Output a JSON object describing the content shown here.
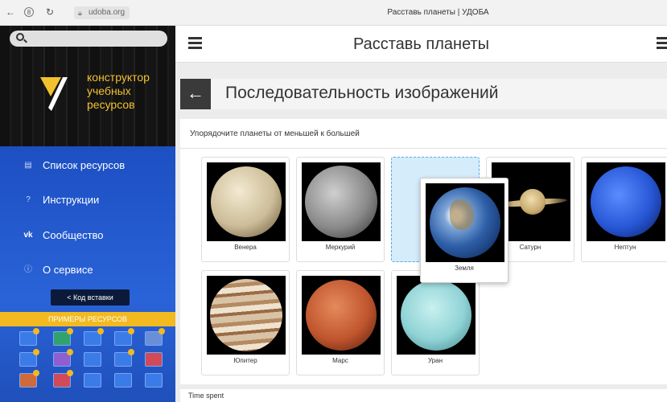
{
  "browser": {
    "back_icon": "back-arrow-icon",
    "url": "udoba.org",
    "tab_title": "Расставь планеты | УДОБА"
  },
  "sidebar": {
    "logo_text": [
      "конструктор",
      "учебных",
      "ресурсов"
    ],
    "logo_colors": {
      "yellow": "#f2c12e",
      "white": "#ffffff"
    },
    "menu": [
      {
        "icon": "list-icon",
        "label": "Список ресурсов"
      },
      {
        "icon": "help-icon",
        "label": "Инструкции"
      },
      {
        "icon": "vk-icon",
        "label": "Сообщество"
      },
      {
        "icon": "info-icon",
        "label": "О сервисе"
      }
    ],
    "embed_label": "Код вставки",
    "examples_label": "ПРИМЕРЫ РЕСУРСОВ"
  },
  "header": {
    "title": "Расставь планеты"
  },
  "exercise": {
    "title": "Последовательность изображений",
    "instruction": "Упорядочите планеты от меньшей к большей",
    "cards": [
      {
        "label": "Венера"
      },
      {
        "label": "Меркурий"
      },
      {
        "label": "Сатурн"
      },
      {
        "label": "Нептун"
      },
      {
        "label": "Юпитер"
      },
      {
        "label": "Марс"
      },
      {
        "label": "Уран"
      }
    ],
    "dragging_card": {
      "label": "Земля"
    }
  },
  "footer": {
    "time_spent": "Time spent"
  },
  "colors": {
    "sidebar_blue": "#2a63d8",
    "accent_yellow": "#f2b920",
    "drop_placeholder": "#d5ecfb"
  }
}
